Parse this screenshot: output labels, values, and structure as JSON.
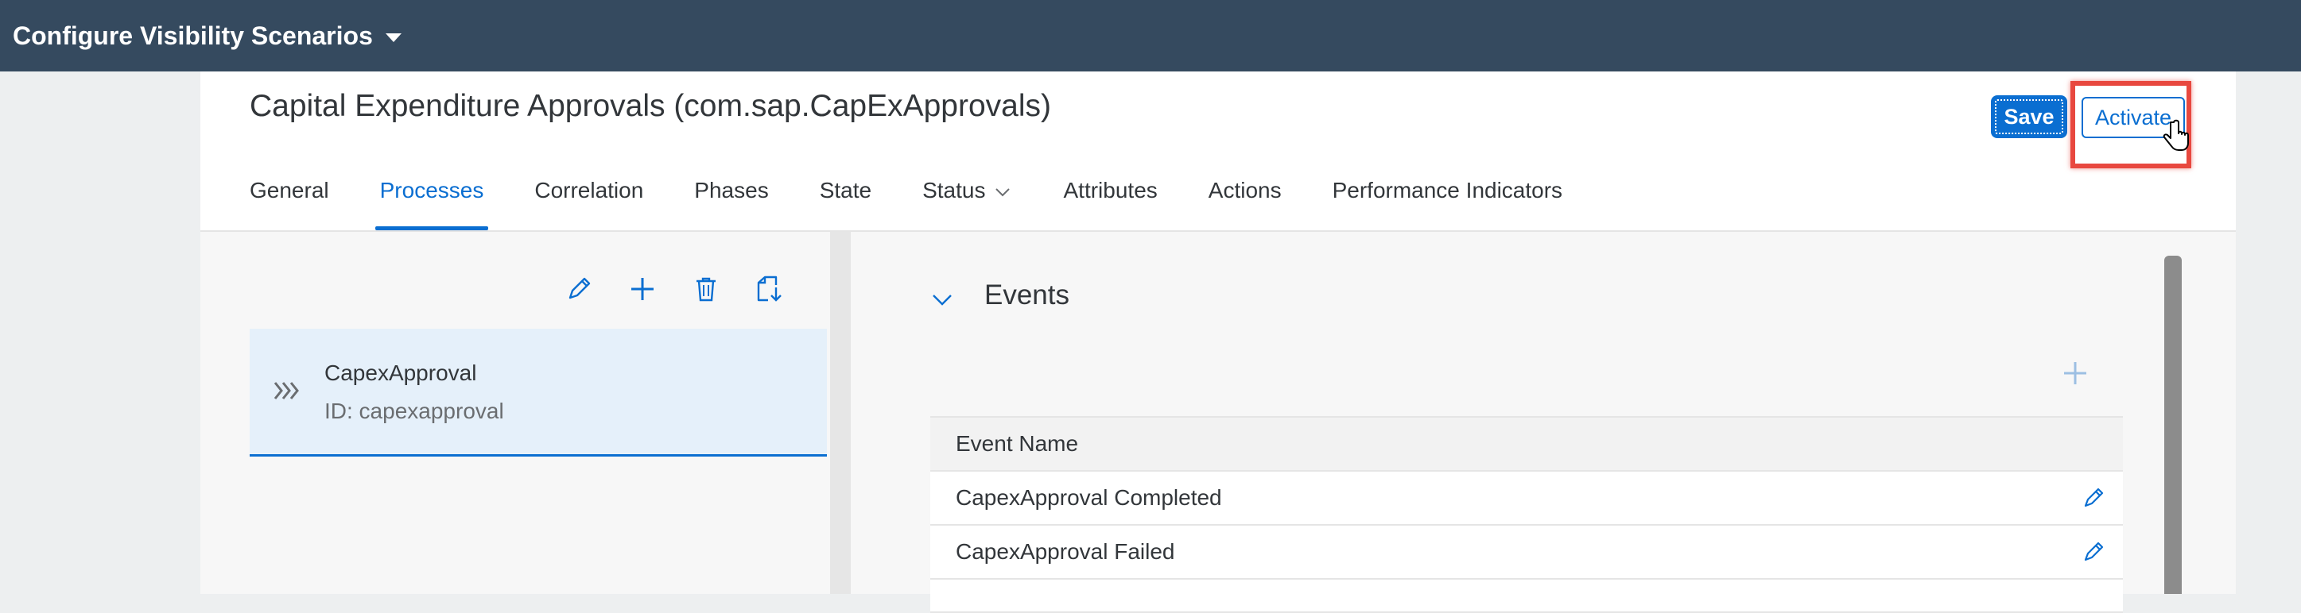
{
  "shell": {
    "title": "Configure Visibility Scenarios"
  },
  "header": {
    "title": "Capital Expenditure Approvals (com.sap.CapExApprovals)",
    "save_label": "Save",
    "activate_label": "Activate"
  },
  "tabs": [
    {
      "label": "General"
    },
    {
      "label": "Processes"
    },
    {
      "label": "Correlation"
    },
    {
      "label": "Phases"
    },
    {
      "label": "State"
    },
    {
      "label": "Status"
    },
    {
      "label": "Attributes"
    },
    {
      "label": "Actions"
    },
    {
      "label": "Performance Indicators"
    }
  ],
  "active_tab": "Processes",
  "process_list": [
    {
      "title": "CapexApproval",
      "id_text": "ID: capexapproval"
    }
  ],
  "events_section": {
    "title": "Events",
    "column_header": "Event Name",
    "rows": [
      {
        "name": "CapexApproval Completed"
      },
      {
        "name": "CapexApproval Failed"
      }
    ]
  },
  "icons": {
    "toolbar": [
      "edit-icon",
      "add-icon",
      "delete-icon",
      "import-icon"
    ],
    "status_tab": "chevron-down-icon"
  },
  "colors": {
    "shell": "#354a5f",
    "accent": "#0a6ed1",
    "highlight": "#e8483f"
  }
}
